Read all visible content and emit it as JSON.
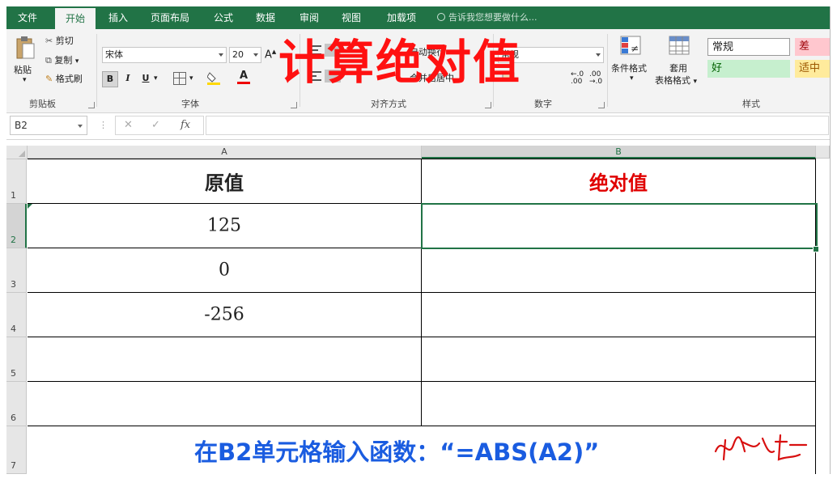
{
  "tabs": [
    {
      "label": "文件"
    },
    {
      "label": "开始"
    },
    {
      "label": "插入"
    },
    {
      "label": "页面布局"
    },
    {
      "label": "公式"
    },
    {
      "label": "数据"
    },
    {
      "label": "审阅"
    },
    {
      "label": "视图"
    },
    {
      "label": "加载项"
    }
  ],
  "tell_me": "告诉我您想要做什么...",
  "clipboard": {
    "paste": "粘贴",
    "cut": "剪切",
    "copy": "复制",
    "format_painter": "格式刷",
    "group": "剪贴板"
  },
  "font": {
    "name": "宋体",
    "size": "20",
    "bold": "B",
    "italic": "I",
    "underline": "U",
    "group": "字体"
  },
  "alignment": {
    "wrap": "自动换行",
    "merge": "合并后居中",
    "group": "对齐方式"
  },
  "number": {
    "format": "常规",
    "group": "数字"
  },
  "styles": {
    "conditional": "条件格式",
    "table1": "套用",
    "table2": "表格格式",
    "normal": "常规",
    "bad": "差",
    "good": "好",
    "neutral": "适中",
    "group": "样式"
  },
  "banner": "计算绝对值",
  "namebox": "B2",
  "columns": [
    "A",
    "B"
  ],
  "rows": [
    "1",
    "2",
    "3",
    "4",
    "5",
    "6",
    "7"
  ],
  "cells": {
    "a1": "原值",
    "b1": "绝对值",
    "a2": "125",
    "a3": "0",
    "a4": "-256"
  },
  "note": "在B2单元格输入函数：“=ABS(A2)”",
  "colors": {
    "accent": "#217346",
    "title_red": "#ff1111",
    "note_blue": "#1a5ce0"
  }
}
